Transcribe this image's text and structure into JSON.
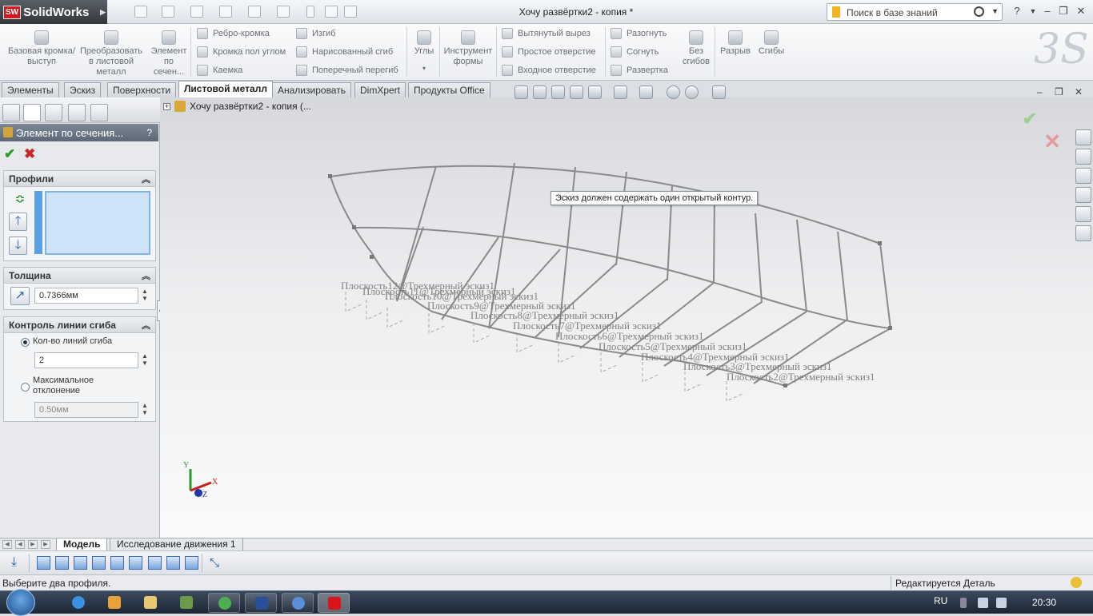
{
  "app": {
    "name": "SolidWorks",
    "badge": "SW",
    "document_title": "Хочу развёртки2 - копия *",
    "search_placeholder": "Поиск в базе знаний",
    "help": "?"
  },
  "ribbon": {
    "big_buttons": [
      {
        "label": "Базовая кромка/выступ",
        "icon": "base-flange-icon"
      },
      {
        "label": "Преобразовать в листовой металл",
        "icon": "convert-sheetmetal-icon"
      },
      {
        "label": "Элемент по сечен...",
        "icon": "lofted-bend-icon"
      }
    ],
    "col1": [
      "Ребро-кромка",
      "Кромка пол углом",
      "Каемка"
    ],
    "col2": [
      "Изгиб",
      "Нарисованный сгиб",
      "Поперечный перегиб"
    ],
    "corners": "Углы",
    "forming_tool": "Инструмент формы",
    "col3": [
      "Вытянутый вырез",
      "Простое отверстие",
      "Входное отверстие"
    ],
    "col4": [
      "Разогнуть",
      "Согнуть",
      "Развертка"
    ],
    "no_bends": "Без сгибов",
    "rip": "Разрыв",
    "bends": "Сгибы"
  },
  "tabs": [
    {
      "label": "Элементы",
      "active": false
    },
    {
      "label": "Эскиз",
      "active": false
    },
    {
      "label": "Поверхности",
      "active": false
    },
    {
      "label": "Листовой металл",
      "active": true
    },
    {
      "label": "Анализировать",
      "active": false
    },
    {
      "label": "DimXpert",
      "active": false
    },
    {
      "label": "Продукты Office",
      "active": false
    }
  ],
  "property_manager": {
    "title": "Элемент по сечения...",
    "help": "?",
    "profiles": {
      "header": "Профили"
    },
    "thickness": {
      "header": "Толщина",
      "value": "0.7366мм"
    },
    "bend_control": {
      "header": "Контроль линии сгиба",
      "option1": "Кол-во линий сгиба",
      "option1_value": "2",
      "option1_selected": true,
      "option2": "Максимальное отклонение",
      "option2_value": "0.50мм"
    }
  },
  "viewport": {
    "tree_root": "Хочу развёртки2 - копия  (...",
    "tooltip": "Эскиз должен содержать один открытый контур.",
    "plane_labels": [
      "Плоскость12@Трехмерный эскиз1",
      "Плоскость11@Трехмерный эскиз1",
      "Плоскость10@Трехмерный эскиз1",
      "Плоскость9@Трехмерный эскиз1",
      "Плоскость8@Трехмерный эскиз1",
      "Плоскость7@Трехмерный эскиз1",
      "Плоскость6@Трехмерный эскиз1",
      "Плоскость5@Трехмерный эскиз1",
      "Плоскость4@Трехмерный эскиз1",
      "Плоскость3@Трехмерный эскиз1",
      "Плоскость2@Трехмерный эскиз1"
    ],
    "triad": {
      "x": "X",
      "y": "Y",
      "z": "Z"
    }
  },
  "model_tabs": [
    {
      "label": "Модель",
      "active": true
    },
    {
      "label": "Исследование движения 1",
      "active": false
    }
  ],
  "status": {
    "left": "Выберите два профиля.",
    "right": "Редактируется Деталь"
  },
  "taskbar": {
    "lang": "RU",
    "clock": "20:30"
  }
}
